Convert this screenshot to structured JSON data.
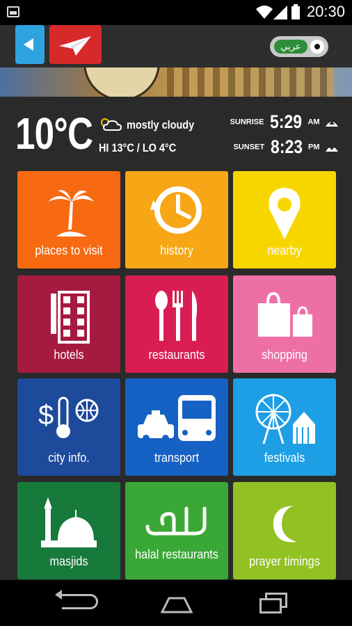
{
  "status": {
    "time": "20:30"
  },
  "header": {
    "lang_label": "عربي"
  },
  "weather": {
    "temp": "10°C",
    "condition": "mostly cloudy",
    "hi": "HI 13°C",
    "lo": "/ LO 4°C",
    "sunrise_label": "SUNRISE",
    "sunrise_time": "5:29",
    "sunrise_ampm": "AM",
    "sunset_label": "SUNSET",
    "sunset_time": "8:23",
    "sunset_ampm": "PM"
  },
  "tiles": [
    {
      "label": "places to visit",
      "color": "#f86a12",
      "icon": "palm-tree-icon"
    },
    {
      "label": "history",
      "color": "#f7a616",
      "icon": "clock-icon"
    },
    {
      "label": "nearby",
      "color": "#f7d600",
      "icon": "location-pin-icon"
    },
    {
      "label": "hotels",
      "color": "#a51b3f",
      "icon": "hotel-building-icon"
    },
    {
      "label": "restaurants",
      "color": "#d91d52",
      "icon": "cutlery-icon"
    },
    {
      "label": "shopping",
      "color": "#ee6fa6",
      "icon": "shopping-bag-icon"
    },
    {
      "label": "city info.",
      "color": "#1d4a9a",
      "icon": "city-info-icon"
    },
    {
      "label": "transport",
      "color": "#1562c4",
      "icon": "transport-icon"
    },
    {
      "label": "festivals",
      "color": "#1d9ee5",
      "icon": "ferris-wheel-icon"
    },
    {
      "label": "masjids",
      "color": "#17793a",
      "icon": "mosque-icon"
    },
    {
      "label": "halal restaurants",
      "color": "#3aa836",
      "icon": "halal-icon"
    },
    {
      "label": "prayer timings",
      "color": "#92c123",
      "icon": "crescent-moon-icon"
    }
  ]
}
